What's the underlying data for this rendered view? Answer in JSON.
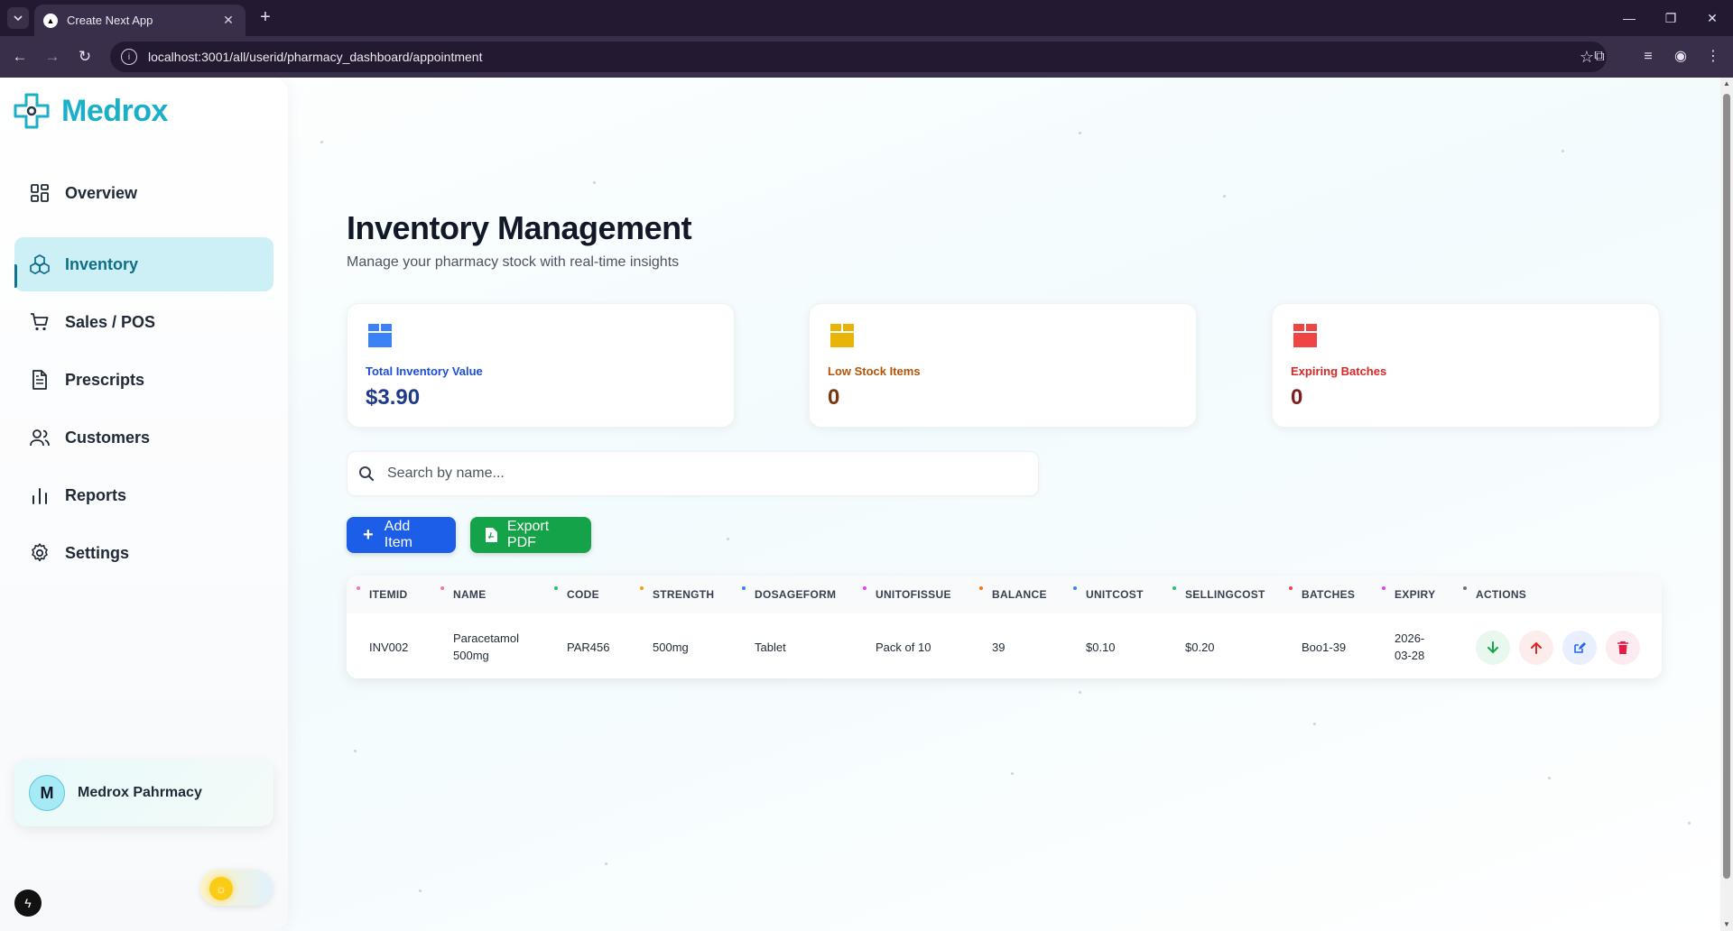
{
  "browser": {
    "tab_title": "Create Next App",
    "url": "localhost:3001/all/userid/pharmacy_dashboard/appointment"
  },
  "sidebar": {
    "brand": "Medrox",
    "items": [
      {
        "label": "Overview",
        "icon": "grid-icon",
        "active": false
      },
      {
        "label": "Inventory",
        "icon": "cubes-icon",
        "active": true
      },
      {
        "label": "Sales / POS",
        "icon": "cart-icon",
        "active": false
      },
      {
        "label": "Prescripts",
        "icon": "document-icon",
        "active": false
      },
      {
        "label": "Customers",
        "icon": "users-icon",
        "active": false
      },
      {
        "label": "Reports",
        "icon": "bar-chart-icon",
        "active": false
      },
      {
        "label": "Settings",
        "icon": "gear-icon",
        "active": false
      }
    ],
    "profile": {
      "initial": "M",
      "name": "Medrox Pahrmacy"
    }
  },
  "main": {
    "title": "Inventory Management",
    "subtitle": "Manage your pharmacy stock with real-time insights",
    "stats": [
      {
        "label": "Total Inventory Value",
        "value": "$3.90",
        "color": "#2563eb",
        "value_color": "#1e3a8a"
      },
      {
        "label": "Low Stock Items",
        "value": "0",
        "color": "#ca8a04",
        "value_color": "#78350f"
      },
      {
        "label": "Expiring Batches",
        "value": "0",
        "color": "#dc2626",
        "value_color": "#7f1d1d"
      }
    ],
    "search_placeholder": "Search by name...",
    "add_label": "Add Item",
    "export_label": "Export PDF"
  },
  "table": {
    "columns": [
      "ITEMID",
      "NAME",
      "CODE",
      "STRENGTH",
      "DOSAGEFORM",
      "UNITOFISSUE",
      "BALANCE",
      "UNITCOST",
      "SELLINGCOST",
      "BATCHES",
      "EXPIRY",
      "ACTIONS"
    ],
    "dot_colors": [
      "#f472b6",
      "#f472b6",
      "#22c55e",
      "#f59e0b",
      "#3b82f6",
      "#d946ef",
      "#f97316",
      "#3b82f6",
      "#22c55e",
      "#ef4444",
      "#d946ef",
      "#6b7280"
    ],
    "rows": [
      {
        "itemid": "INV002",
        "name_line1": "Paracetamol",
        "name_line2": "500mg",
        "code": "PAR456",
        "strength": "500mg",
        "dosageform": "Tablet",
        "unitofissue": "Pack of 10",
        "balance": "39",
        "unitcost": "$0.10",
        "sellingcost": "$0.20",
        "batches": "Boo1-39",
        "expiry_line1": "2026-",
        "expiry_line2": "03-28"
      }
    ]
  },
  "colors": {
    "brand": "#1cb0c8",
    "active_bg": "#ccf0f6",
    "add_btn": "#1d5ee8",
    "export_btn": "#15a34a"
  }
}
